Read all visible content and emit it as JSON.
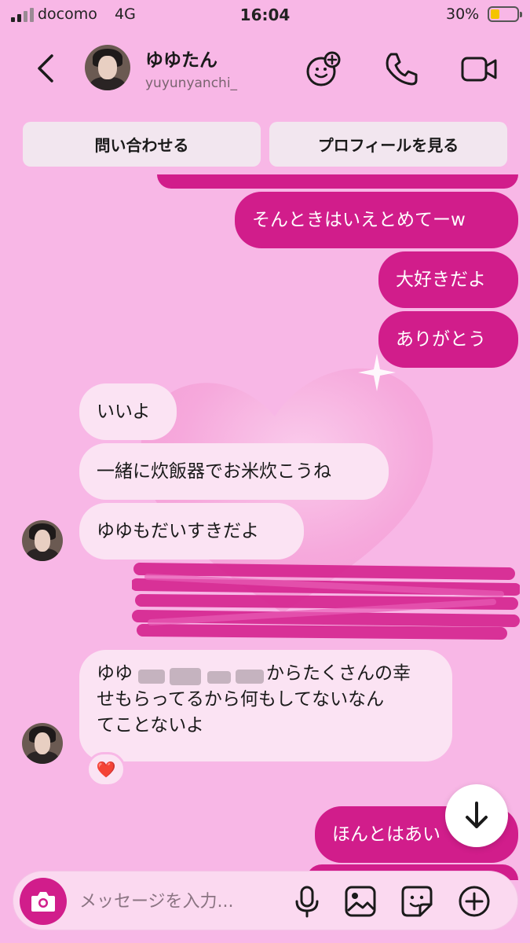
{
  "status": {
    "carrier": "docomo",
    "network": "4G",
    "time": "16:04",
    "battery": "30%",
    "battery_level": 0.3
  },
  "header": {
    "name": "ゆゆたん",
    "handle": "yuyunyanchi_",
    "icons": [
      "back-arrow-icon",
      "effects-icon",
      "phone-icon",
      "video-camera-icon"
    ]
  },
  "actions": {
    "contact": "問い合わせる",
    "profile": "プロフィールを見る"
  },
  "messages": [
    {
      "from": "me",
      "text": "そんときはいえとめてーw"
    },
    {
      "from": "me",
      "text": "大好きだよ"
    },
    {
      "from": "me",
      "text": "ありがとう"
    },
    {
      "from": "them",
      "text": "いいよ"
    },
    {
      "from": "them",
      "text": "一緒に炊飯器でお米炊こうね"
    },
    {
      "from": "them",
      "text": "ゆゆもだいすきだよ"
    },
    {
      "from": "them",
      "lines": [
        "ゆゆ",
        "からたくさんの幸",
        "せもらってるから何もしてないなん",
        "てことないよ"
      ],
      "reaction": "❤️"
    },
    {
      "from": "me",
      "text": "ほんとはあい"
    }
  ],
  "composer": {
    "placeholder": "メッセージを入力...",
    "icons": [
      "camera-icon",
      "microphone-icon",
      "image-icon",
      "sticker-icon",
      "plus-icon"
    ]
  },
  "colors": {
    "background": "#f8b7e6",
    "sent_bubble": "#d11d8b",
    "received_bubble": "#fbe3f3"
  }
}
